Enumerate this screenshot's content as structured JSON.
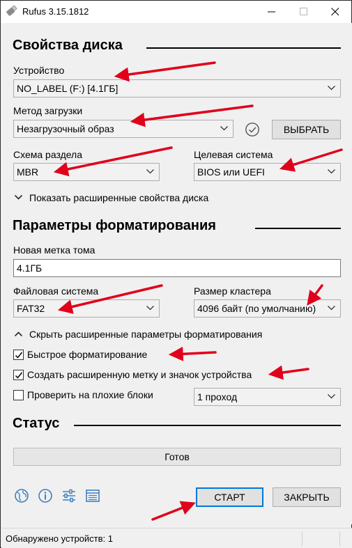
{
  "window": {
    "title": "Rufus 3.15.1812",
    "icon": "usb-drive-icon"
  },
  "drive_properties": {
    "heading": "Свойства диска",
    "device_label": "Устройство",
    "device_value": "NO_LABEL (F:) [4.1ГБ]",
    "boot_label": "Метод загрузки",
    "boot_value": "Незагрузочный образ",
    "select_button": "ВЫБРАТЬ",
    "partition_label": "Схема раздела",
    "partition_value": "MBR",
    "target_label": "Целевая система",
    "target_value": "BIOS или UEFI",
    "advanced_toggle": "Показать расширенные свойства диска"
  },
  "format_options": {
    "heading": "Параметры форматирования",
    "volume_label_caption": "Новая метка тома",
    "volume_label_value": "4.1ГБ",
    "fs_label": "Файловая система",
    "fs_value": "FAT32",
    "cluster_label": "Размер кластера",
    "cluster_value": "4096 байт (по умолчанию)",
    "advanced_toggle": "Скрыть расширенные параметры форматирования",
    "quick_format": {
      "label": "Быстрое форматирование",
      "checked": true
    },
    "extended_label": {
      "label": "Создать расширенную метку и значок устройства",
      "checked": true
    },
    "bad_blocks": {
      "label": "Проверить на плохие блоки",
      "checked": false
    },
    "passes_value": "1 проход"
  },
  "status": {
    "heading": "Статус",
    "progress_text": "Готов"
  },
  "toolbar": {
    "icons": [
      "globe-icon",
      "info-icon",
      "settings-sliders-icon",
      "log-icon"
    ]
  },
  "actions": {
    "start": "СТАРТ",
    "close": "ЗАКРЫТЬ"
  },
  "statusbar": {
    "text": "Обнаружено устройств: 1"
  },
  "colors": {
    "accent": "#0078d7",
    "arrow": "#e0001b",
    "window_bg": "#f0f0f0"
  }
}
